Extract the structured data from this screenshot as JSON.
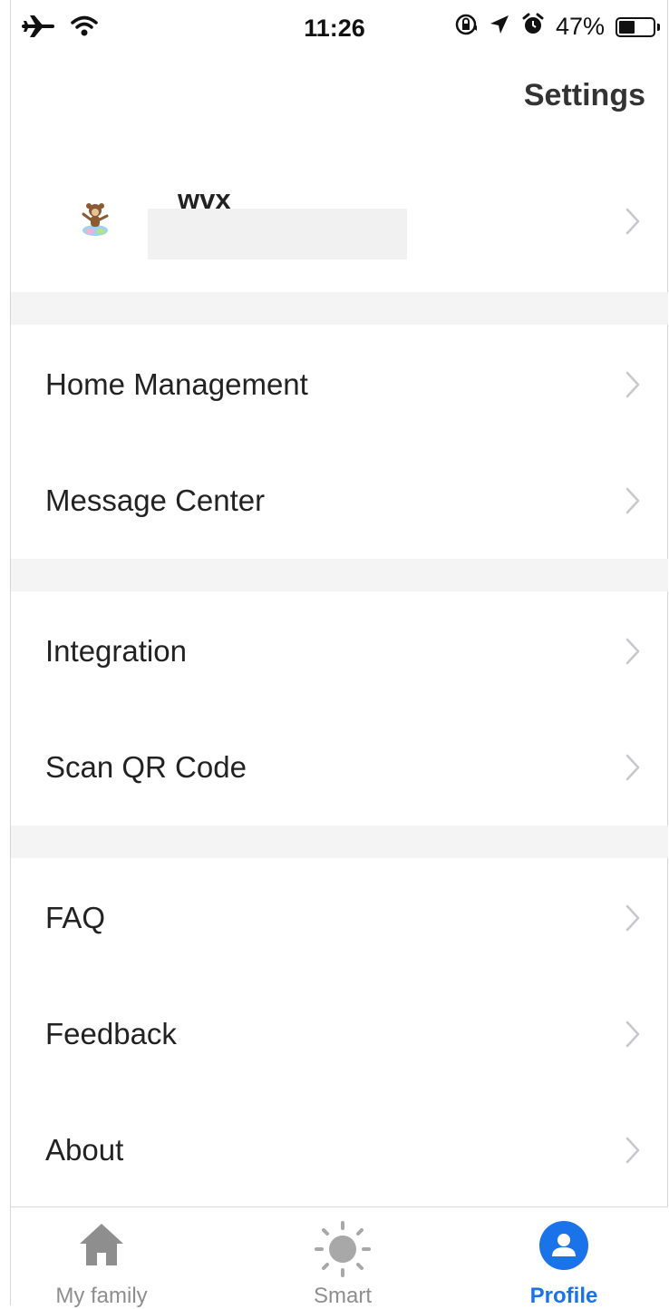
{
  "status_bar": {
    "time": "11:26",
    "battery_percent": "47%",
    "battery_level": 0.47,
    "icons": [
      "airplane-icon",
      "wifi-icon",
      "orientation-lock-icon",
      "location-icon",
      "alarm-icon",
      "battery-icon"
    ]
  },
  "header": {
    "settings_label": "Settings"
  },
  "profile": {
    "username": "wvx",
    "avatar_icon": "monkey-avatar-icon"
  },
  "menu": {
    "home_management": "Home Management",
    "message_center": "Message Center",
    "integration": "Integration",
    "scan_qr_code": "Scan QR Code",
    "faq": "FAQ",
    "feedback": "Feedback",
    "about": "About"
  },
  "tabs": {
    "my_family": "My family",
    "smart": "Smart",
    "profile": "Profile",
    "active": "profile"
  },
  "colors": {
    "accent": "#1a73e8",
    "inactive_tab": "#8e8e8e",
    "section_gap": "#f4f4f4",
    "chevron": "#c7c7cc"
  }
}
